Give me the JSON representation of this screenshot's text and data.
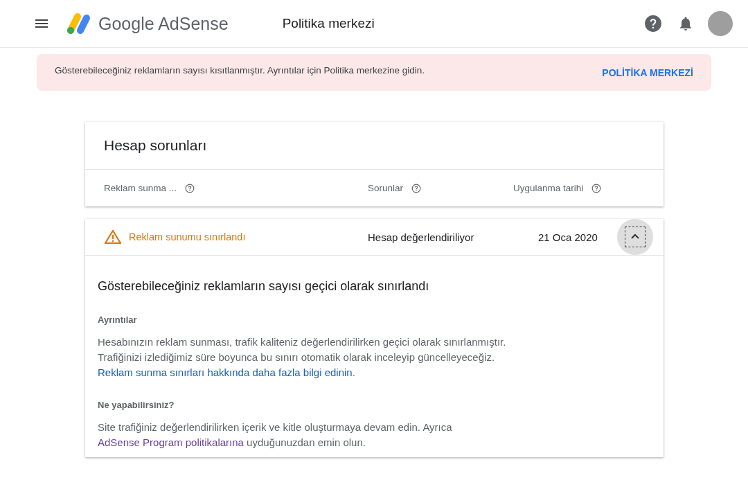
{
  "header": {
    "brand": "Google AdSense",
    "page_title": "Politika merkezi"
  },
  "banner": {
    "message": "Gösterebileceğiniz reklamların sayısı kısıtlanmıştır. Ayrıntılar için Politika merkezine gidin.",
    "action": "POLİTİKA MERKEZİ"
  },
  "issues_card": {
    "title": "Hesap sorunları",
    "columns": [
      "Reklam sunma ...",
      "Sorunlar",
      "Uygulanma tarihi"
    ]
  },
  "issue": {
    "status": "Reklam sunumu sınırlandı",
    "problem": "Hesap değerlendiriliyor",
    "date": "21 Oca 2020",
    "expanded": true,
    "heading": "Gösterebileceğiniz reklamların sayısı geçici olarak sınırlandı",
    "sections": [
      {
        "title": "Ayrıntılar",
        "text": "Hesabınızın reklam sunması, trafik kaliteniz değerlendirilirken geçici olarak sınırlanmıştır. Trafiğinizi izlediğimiz süre boyunca bu sınırı otomatik olarak inceleyip güncelleyeceğiz.",
        "link_line": {
          "link": "Reklam sunma sınırları hakkında daha fazla bilgi edinin",
          "after": "."
        }
      },
      {
        "title": "Ne yapabilirsiniz?",
        "text": "Site trafiğiniz değerlendirilirken içerik ve kitle oluşturmaya devam edin. Ayrıca",
        "link": "AdSense Program politikalarına",
        "after": "uyduğunuzdan emin olun."
      }
    ]
  }
}
